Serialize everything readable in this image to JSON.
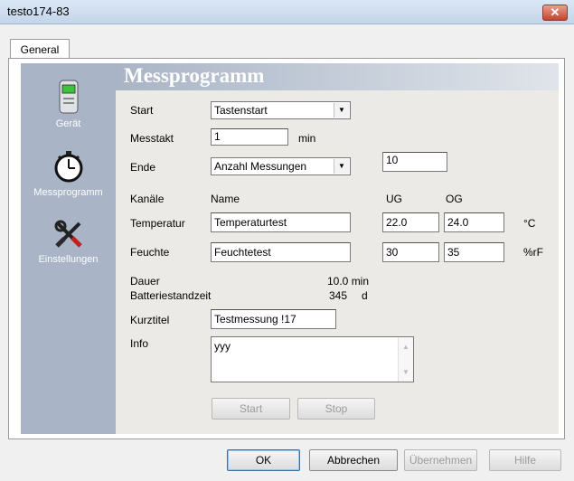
{
  "window": {
    "title": "testo174-83",
    "close_symbol": "✕"
  },
  "tabs": [
    {
      "label": "General"
    }
  ],
  "sidebar": {
    "items": [
      {
        "label": "Gerät",
        "icon": "device-icon"
      },
      {
        "label": "Messprogramm",
        "icon": "stopwatch-icon"
      },
      {
        "label": "Einstellungen",
        "icon": "tools-icon"
      }
    ]
  },
  "section": {
    "title": "Messprogramm"
  },
  "form": {
    "start_label": "Start",
    "start_value": "Tastenstart",
    "messtakt_label": "Messtakt",
    "messtakt_value": "1",
    "messtakt_unit": "min",
    "ende_label": "Ende",
    "ende_value": "Anzahl Messungen",
    "ende_count": "10",
    "kanaele_header": "Kanäle",
    "name_header": "Name",
    "ug_header": "UG",
    "og_header": "OG",
    "channels": [
      {
        "label": "Temperatur",
        "name": "Temperaturtest",
        "ug": "22.0",
        "og": "24.0",
        "unit": "°C"
      },
      {
        "label": "Feuchte",
        "name": "Feuchtetest",
        "ug": "30",
        "og": "35",
        "unit": "%rF"
      }
    ],
    "dauer_label": "Dauer",
    "dauer_value": "10.0 min",
    "batterie_label": "Batteriestandzeit",
    "batterie_value": "345",
    "batterie_unit": "d",
    "kurztitel_label": "Kurztitel",
    "kurztitel_value": "Testmessung !17",
    "info_label": "Info",
    "info_value": "yyy",
    "start_button": "Start",
    "stop_button": "Stop"
  },
  "footer": {
    "ok": "OK",
    "abbrechen": "Abbrechen",
    "uebernehmen": "Übernehmen",
    "hilfe": "Hilfe"
  }
}
